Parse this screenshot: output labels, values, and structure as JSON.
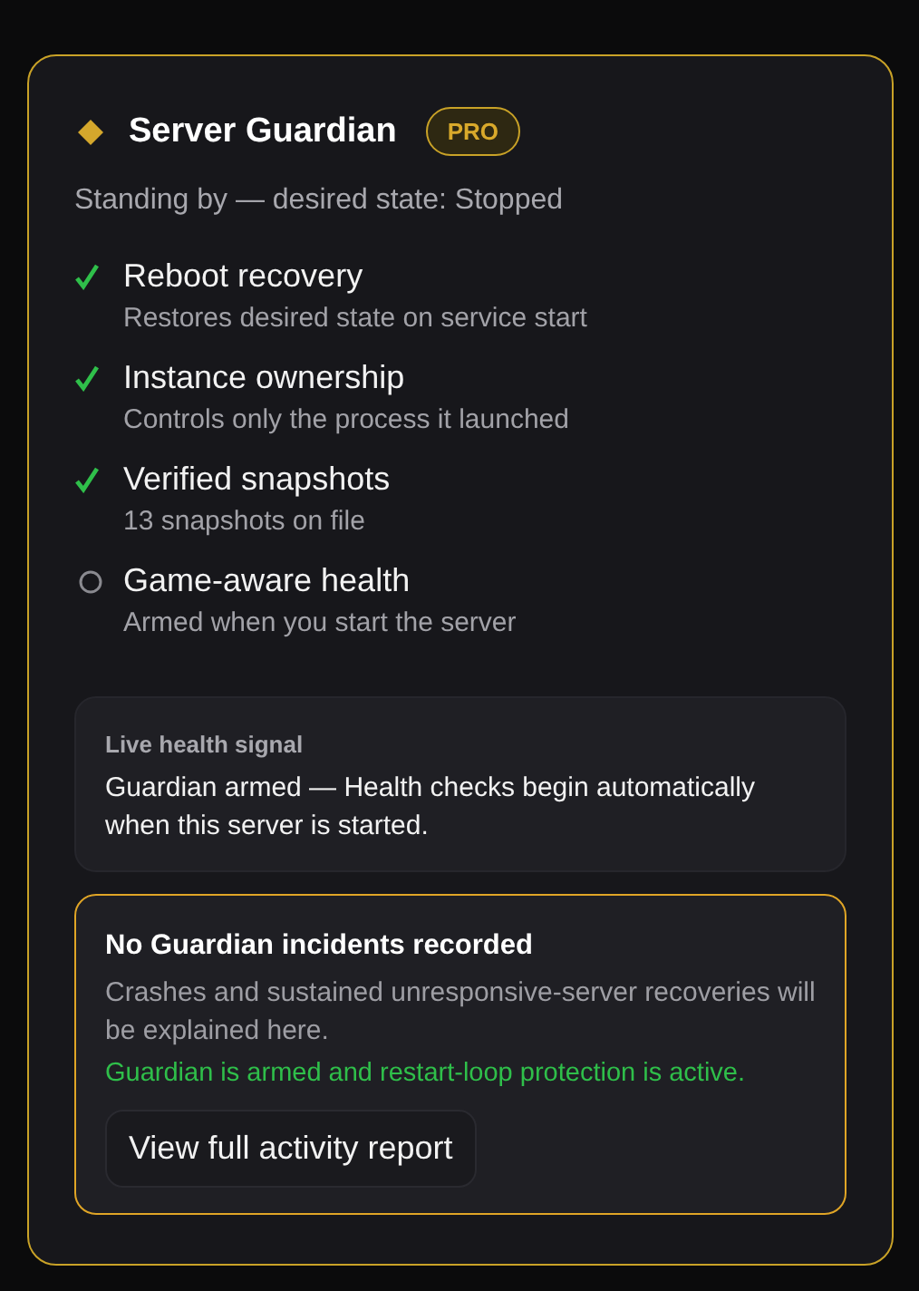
{
  "header": {
    "title": "Server Guardian",
    "badge": "PRO",
    "status": "Standing by — desired state: Stopped"
  },
  "features": [
    {
      "title": "Reboot recovery",
      "detail": "Restores desired state on service start",
      "checked": true
    },
    {
      "title": "Instance ownership",
      "detail": "Controls only the process it launched",
      "checked": true
    },
    {
      "title": "Verified snapshots",
      "detail": "13 snapshots on file",
      "checked": true
    },
    {
      "title": "Game-aware health",
      "detail": "Armed when you start the server",
      "checked": false
    }
  ],
  "health_signal": {
    "label": "Live health signal",
    "message": "Guardian armed — Health checks begin automatically when this server is started."
  },
  "incidents": {
    "title": "No Guardian incidents recorded",
    "description": "Crashes and sustained unresponsive-server recoveries will be explained here.",
    "status": "Guardian is armed and restart-loop protection is active.",
    "button": "View full activity report"
  }
}
